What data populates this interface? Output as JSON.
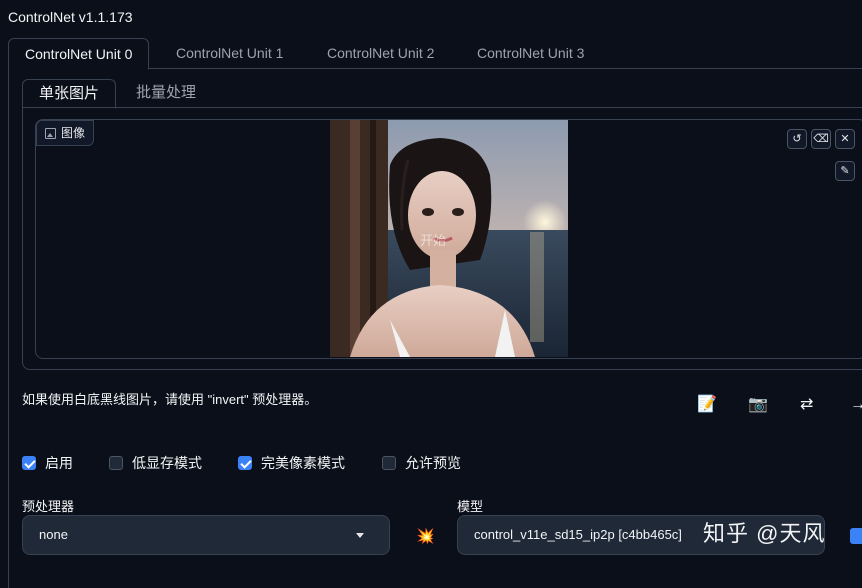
{
  "app": {
    "title": "ControlNet v1.1.173"
  },
  "unit_tabs": [
    {
      "label": "ControlNet Unit 0"
    },
    {
      "label": "ControlNet Unit 1"
    },
    {
      "label": "ControlNet Unit 2"
    },
    {
      "label": "ControlNet Unit 3"
    }
  ],
  "sub_tabs": [
    {
      "label": "单张图片"
    },
    {
      "label": "批量处理"
    }
  ],
  "image": {
    "label": "图像",
    "overlay_text": "开始",
    "tools": {
      "reset_icon": "undo-icon",
      "erase_icon": "eraser-icon",
      "close_icon": "close-icon",
      "brush_icon": "brush-icon"
    }
  },
  "hint": "如果使用白底黑线图片，请使用 \"invert\" 预处理器。",
  "action_icons": [
    "memo-icon",
    "camera-icon",
    "swap-icon",
    "arrow-icon"
  ],
  "checkboxes": [
    {
      "label": "启用",
      "checked": true
    },
    {
      "label": "低显存模式",
      "checked": false
    },
    {
      "label": "完美像素模式",
      "checked": true
    },
    {
      "label": "允许预览",
      "checked": false
    }
  ],
  "preprocessor": {
    "label": "预处理器",
    "value": "none"
  },
  "model": {
    "label": "模型",
    "value": "control_v11e_sd15_ip2p [c4bb465c]"
  },
  "run_icon": "explosion-icon",
  "watermark": "知乎 @天风",
  "colors": {
    "background": "#0b0f19",
    "accent": "#3b82f6",
    "border": "#374151"
  }
}
